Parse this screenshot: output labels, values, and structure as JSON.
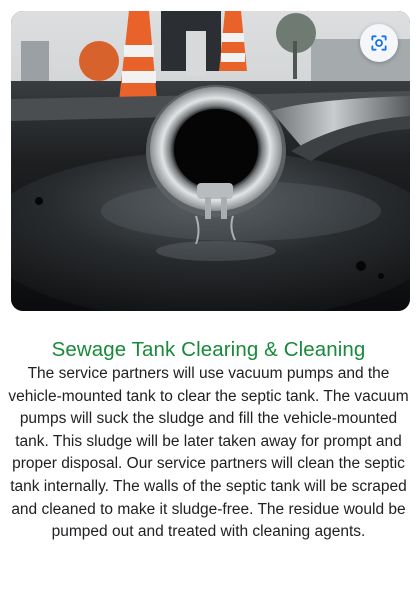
{
  "image": {
    "alt": "Sewage suction hose on wet pavement with traffic cones",
    "icon": "google-lens-icon"
  },
  "service": {
    "title": "Sewage Tank Clearing & Cleaning",
    "description": "The service partners will use vacuum pumps and the vehicle-mounted tank to clear the septic tank. The vacuum pumps will suck the sludge and fill the vehicle-mounted tank. This sludge will be later taken away for prompt and proper disposal. Our service partners will clean the septic tank internally. The walls of the septic tank will be scraped and cleaned to make it sludge-free. The residue would be pumped out and treated with cleaning agents."
  },
  "colors": {
    "title": "#188a3a",
    "text": "#202124",
    "cone_orange": "#e8622a"
  }
}
